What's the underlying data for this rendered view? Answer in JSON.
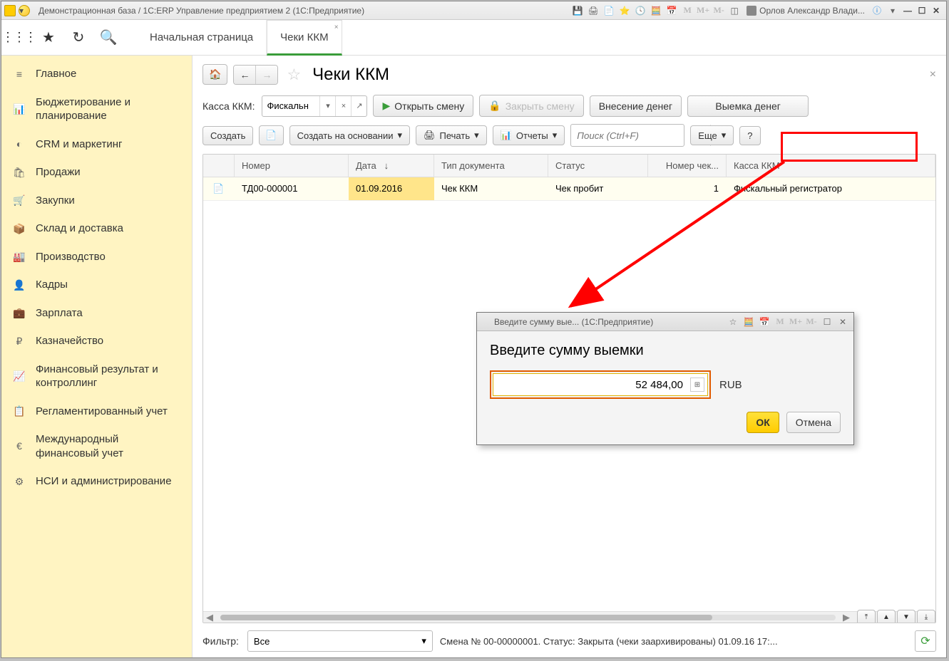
{
  "titlebar": {
    "title": "Демонстрационная база / 1С:ERP Управление предприятием 2  (1С:Предприятие)",
    "user": "Орлов Александр Влади..."
  },
  "maintabs": {
    "home": "Начальная страница",
    "checks": "Чеки ККМ"
  },
  "sidebar": [
    {
      "icon": "≡",
      "label": "Главное"
    },
    {
      "icon": "📊",
      "label": "Бюджетирование и планирование"
    },
    {
      "icon": "◐",
      "label": "CRM и маркетинг"
    },
    {
      "icon": "🛍",
      "label": "Продажи"
    },
    {
      "icon": "🛒",
      "label": "Закупки"
    },
    {
      "icon": "📦",
      "label": "Склад и доставка"
    },
    {
      "icon": "🏭",
      "label": "Производство"
    },
    {
      "icon": "👤",
      "label": "Кадры"
    },
    {
      "icon": "💼",
      "label": "Зарплата"
    },
    {
      "icon": "₽",
      "label": "Казначейство"
    },
    {
      "icon": "📈",
      "label": "Финансовый результат и контроллинг"
    },
    {
      "icon": "📋",
      "label": "Регламентированный учет"
    },
    {
      "icon": "€",
      "label": "Международный финансовый учет"
    },
    {
      "icon": "⚙",
      "label": "НСИ и администрирование"
    }
  ],
  "page": {
    "title": "Чеки ККМ",
    "kassa_label": "Касса ККМ:",
    "kassa_value": "Фискальн",
    "open_shift": "Открыть смену",
    "close_shift": "Закрыть смену",
    "deposit": "Внесение денег",
    "withdraw": "Выемка денег",
    "create": "Создать",
    "create_based": "Создать на основании",
    "print": "Печать",
    "reports": "Отчеты",
    "search_placeholder": "Поиск (Ctrl+F)",
    "more": "Еще",
    "help": "?"
  },
  "table": {
    "headers": {
      "number": "Номер",
      "date": "Дата",
      "sort": "↓",
      "type": "Тип документа",
      "status": "Статус",
      "check_no": "Номер чек...",
      "kassa": "Касса ККМ"
    },
    "rows": [
      {
        "icon": "✓",
        "number": "ТД00-000001",
        "date": "01.09.2016",
        "type": "Чек ККМ",
        "status": "Чек пробит",
        "check_no": "1",
        "kassa": "Фискальный регистратор"
      }
    ]
  },
  "dialog": {
    "title": "Введите сумму вые... (1С:Предприятие)",
    "heading": "Введите сумму выемки",
    "amount": "52 484,00",
    "currency": "RUB",
    "ok": "ОК",
    "cancel": "Отмена"
  },
  "footer": {
    "filter_label": "Фильтр:",
    "filter_value": "Все",
    "status": "Смена № 00-00000001. Статус: Закрыта (чеки заархивированы) 01.09.16 17:..."
  }
}
